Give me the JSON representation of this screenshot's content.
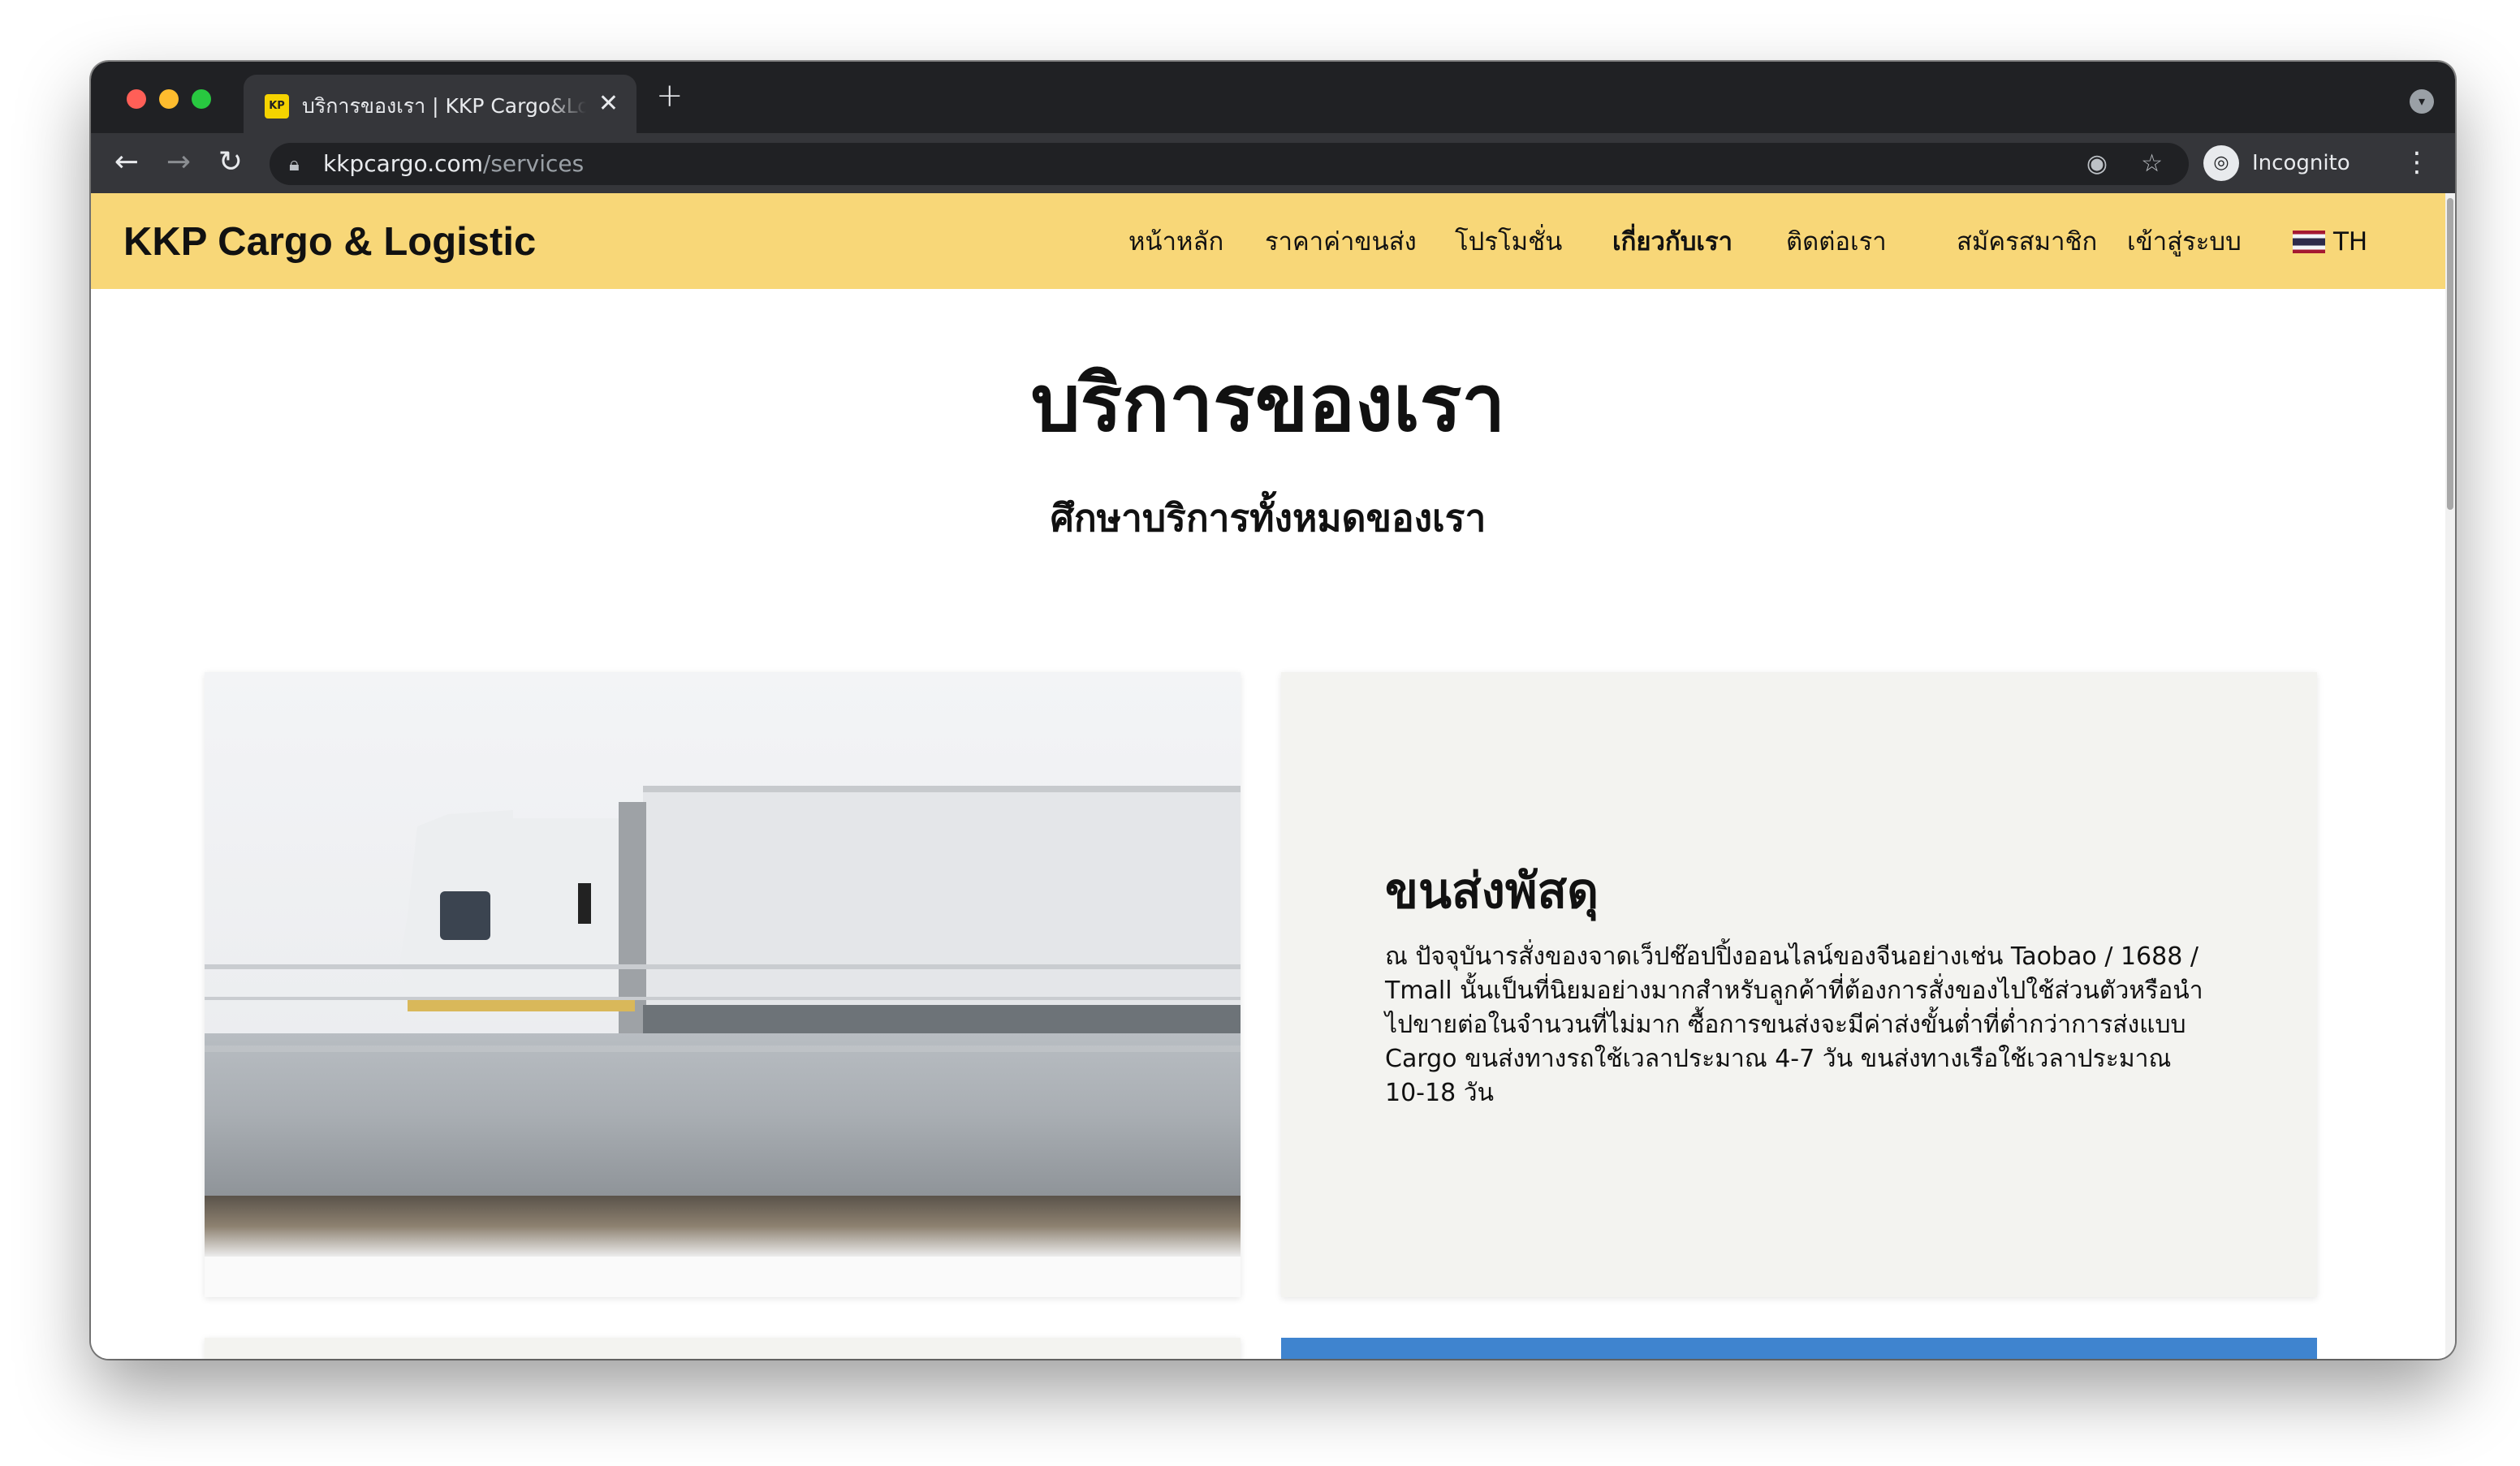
{
  "browser": {
    "tab_title": "บริการของเรา | KKP Cargo&Logistic",
    "favicon_text": "KP",
    "url_host": "kkpcargo.com",
    "url_path": "/services",
    "profile_label": "Incognito"
  },
  "site": {
    "brand": "KKP Cargo & Logistic",
    "accent_color": "#f8d778",
    "nav": [
      {
        "label": "หน้าหลัก"
      },
      {
        "label": "ราคาค่าขนส่ง"
      },
      {
        "label": "โปรโมชั่น"
      },
      {
        "label": "เกี่ยวกับเรา",
        "active": true
      },
      {
        "label": "ติดต่อเรา"
      },
      {
        "label": "สมัครสมาชิก"
      },
      {
        "label": "เข้าสู่ระบบ"
      }
    ],
    "language": "TH"
  },
  "page": {
    "title": "บริการของเรา",
    "subtitle": "ศึกษาบริการทั้งหมดของเรา"
  },
  "services": [
    {
      "title": "ขนส่งพัสดุ",
      "description": "ณ ปัจจุบันารสั่งของจาดเว็ปช๊อปปิ้งออนไลน์ของจีนอย่างเช่น Taobao / 1688 / Tmall นั้นเป็นที่นิยมอย่างมากสำหรับลูกค้าที่ต้องการสั่งของไปใช้ส่วนตัวหรือนำไปขายต่อในจำนวนที่ไม่มาก ซื้อการขนส่งจะมีค่าส่งขั้นต่ำที่ต่ำกว่าการส่งแบบ Cargo ขนส่งทางรถใช้เวลาประมาณ 4-7 วัน ขนส่งทางเรือใช้เวลาประมาณ 10-18 วัน",
      "image": "white-truck-on-highway"
    },
    {
      "image": "port-crane-blue-sky"
    }
  ]
}
